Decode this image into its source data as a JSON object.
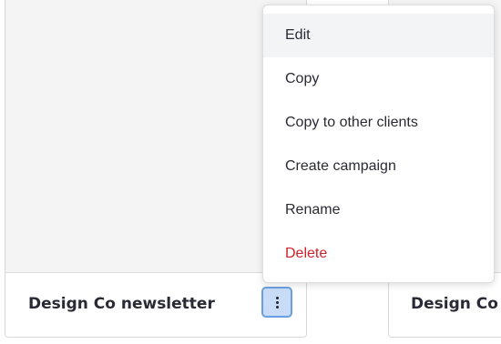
{
  "cards": [
    {
      "title": "Design Co newsletter",
      "menu_button": "more-options"
    },
    {
      "title": "Design Co a"
    }
  ],
  "context_menu": {
    "items": [
      {
        "label": "Edit",
        "state": "hover"
      },
      {
        "label": "Copy"
      },
      {
        "label": "Copy to other clients"
      },
      {
        "label": "Create campaign"
      },
      {
        "label": "Rename"
      },
      {
        "label": "Delete",
        "variant": "danger"
      }
    ]
  },
  "colors": {
    "danger": "#d0202a",
    "kebab_background": "#c8dcf8",
    "kebab_border": "#6aa0e0",
    "hover_background": "#f3f4f6"
  },
  "icons": {
    "kebab": "vertical-ellipsis-icon"
  }
}
